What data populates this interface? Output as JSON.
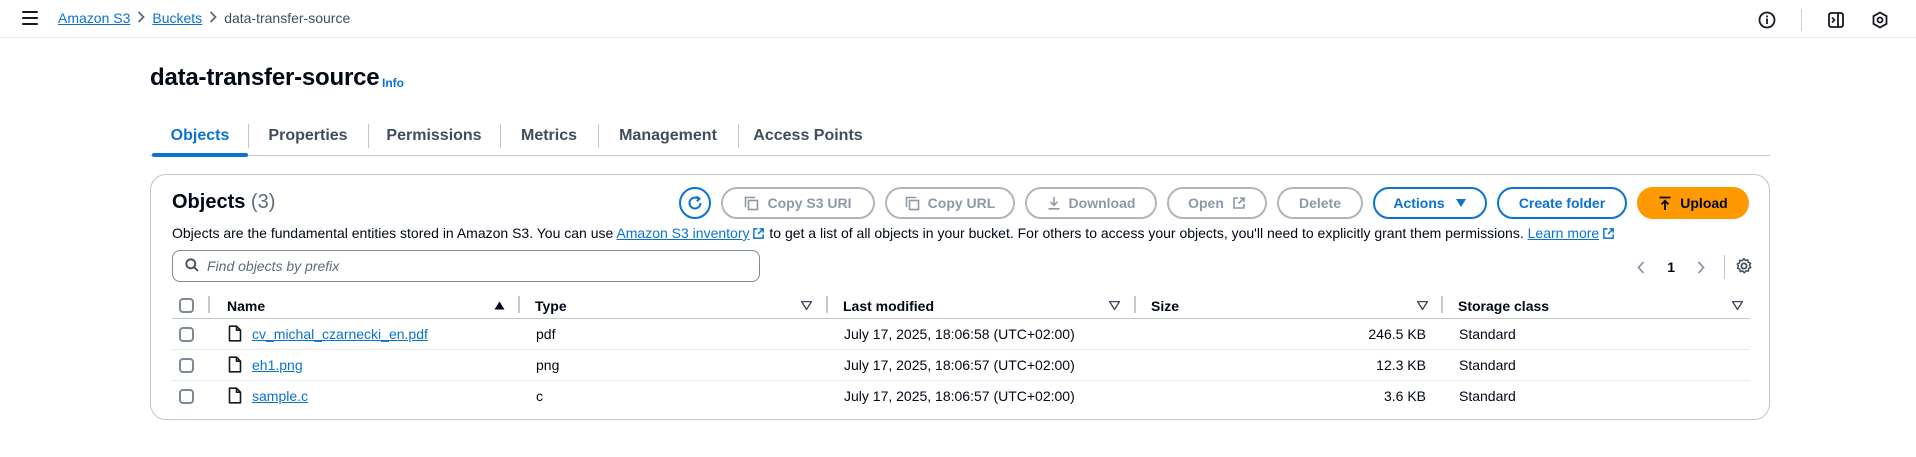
{
  "breadcrumb": {
    "items": [
      "Amazon S3",
      "Buckets"
    ],
    "current": "data-transfer-source"
  },
  "bucket": {
    "title": "data-transfer-source",
    "info": "Info"
  },
  "tabs": [
    "Objects",
    "Properties",
    "Permissions",
    "Metrics",
    "Management",
    "Access Points"
  ],
  "objects_panel": {
    "title": "Objects",
    "count": "(3)",
    "description_before": "Objects are the fundamental entities stored in Amazon S3. You can use ",
    "inventory_link": "Amazon S3 inventory",
    "description_after": " to get a list of all objects in your bucket. For others to access your objects, you'll need to explicitly grant them permissions. ",
    "learn_more": "Learn more",
    "buttons": {
      "copy_s3_uri": "Copy S3 URI",
      "copy_url": "Copy URL",
      "download": "Download",
      "open": "Open",
      "delete": "Delete",
      "actions": "Actions",
      "create_folder": "Create folder",
      "upload": "Upload"
    },
    "search_placeholder": "Find objects by prefix",
    "page": "1"
  },
  "table": {
    "columns": [
      "Name",
      "Type",
      "Last modified",
      "Size",
      "Storage class"
    ],
    "rows": [
      {
        "name": "cv_michal_czarnecki_en.pdf",
        "type": "pdf",
        "modified": "July 17, 2025, 18:06:58 (UTC+02:00)",
        "size": "246.5 KB",
        "storage": "Standard"
      },
      {
        "name": "eh1.png",
        "type": "png",
        "modified": "July 17, 2025, 18:06:57 (UTC+02:00)",
        "size": "12.3 KB",
        "storage": "Standard"
      },
      {
        "name": "sample.c",
        "type": "c",
        "modified": "July 17, 2025, 18:06:57 (UTC+02:00)",
        "size": "3.6 KB",
        "storage": "Standard"
      }
    ]
  },
  "colors": {
    "link": "#0972d3",
    "primary": "#ff9900",
    "text": "#000716"
  }
}
